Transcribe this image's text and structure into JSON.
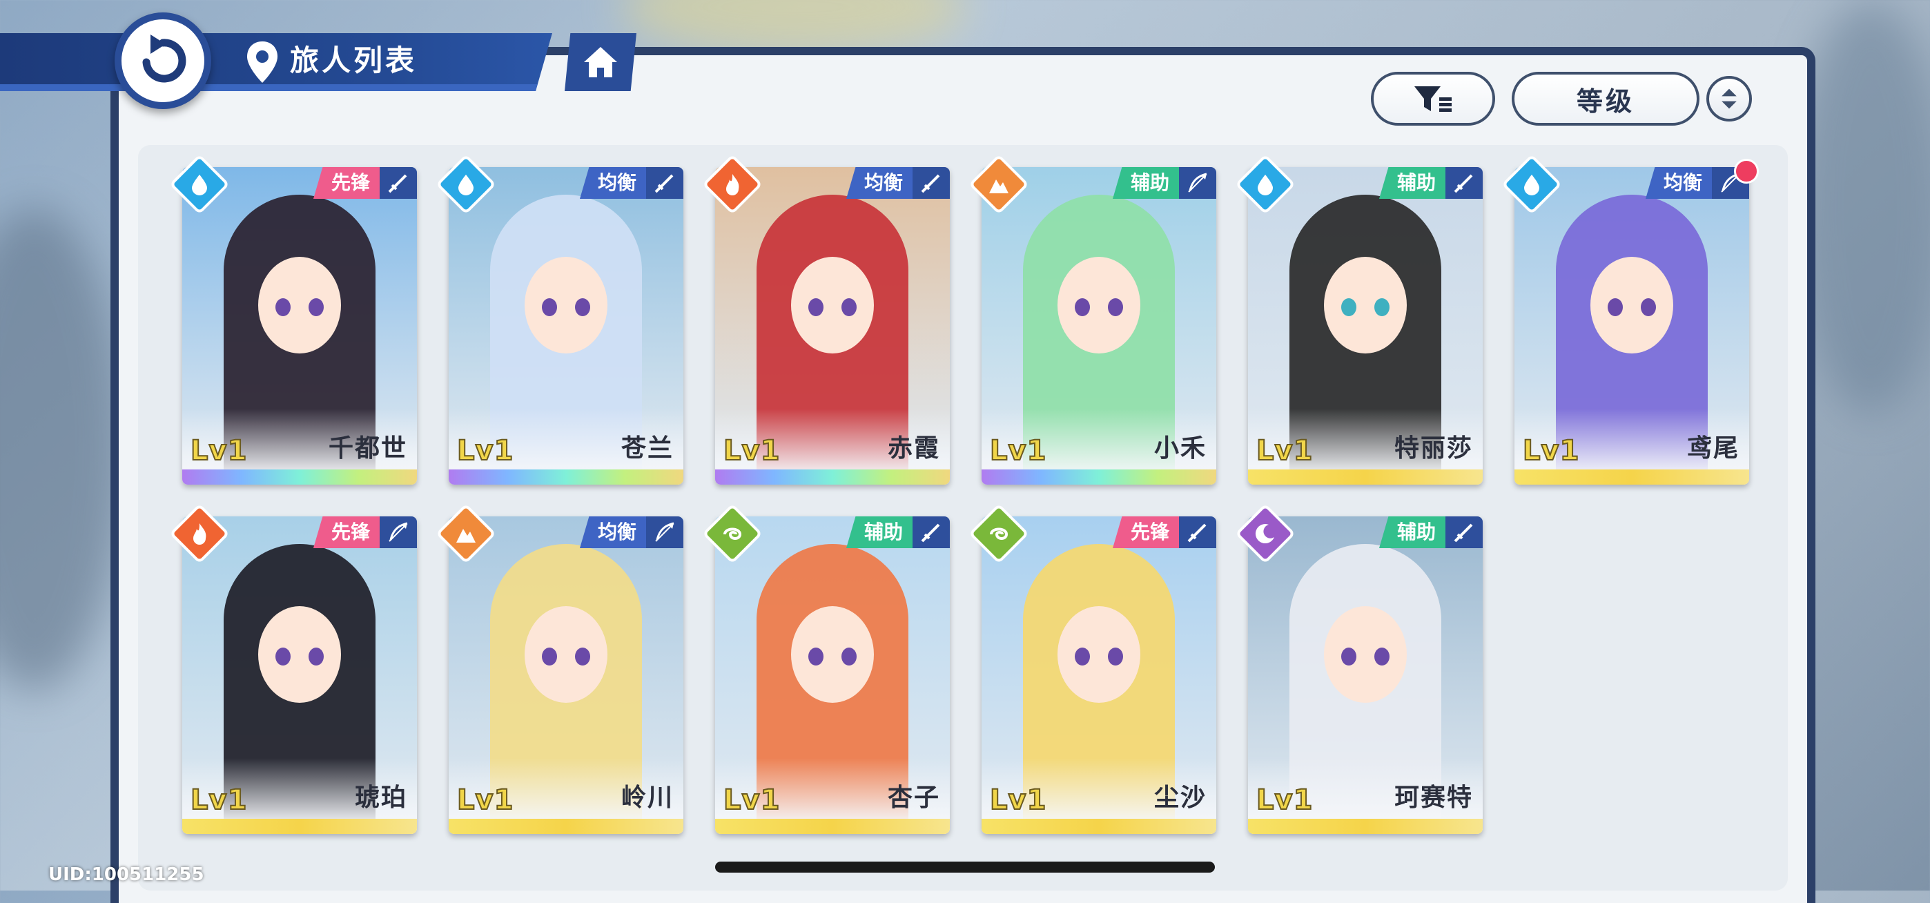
{
  "header": {
    "title": "旅人列表"
  },
  "toolbar": {
    "sort_label": "等级"
  },
  "footer": {
    "uid": "UID:100511255"
  },
  "colors": {
    "water": "#29a9e6",
    "fire": "#f06432",
    "earth": "#f08a3a",
    "wind": "#7ab83a",
    "dark": "#9a5ac8",
    "vanguard": "#ef5c8c",
    "balance": "#3e64c4",
    "support": "#33c08d",
    "rarity_rainbow": "linear-gradient(90deg,#b07cf0,#7fb6ff,#7ff0d8,#c3f07f,#f0d87f)",
    "rarity_gold": "linear-gradient(90deg,#f7e267,#f5d44a,#f7e58e)"
  },
  "characters": [
    {
      "name": "千都世",
      "level": "Lv1",
      "role": "先锋",
      "element": "water",
      "weapon": "sword",
      "rarity": "rainbow",
      "hair": "#2a2230",
      "bg": "#7fb8e8"
    },
    {
      "name": "苍兰",
      "level": "Lv1",
      "role": "均衡",
      "element": "water",
      "weapon": "sword",
      "rarity": "rainbow",
      "hair": "#cfe0f5",
      "bg": "#8fbfe0"
    },
    {
      "name": "赤霞",
      "level": "Lv1",
      "role": "均衡",
      "element": "fire",
      "weapon": "sword",
      "rarity": "rainbow",
      "hair": "#c8343a",
      "bg": "#e0c0a0"
    },
    {
      "name": "小禾",
      "level": "Lv1",
      "role": "辅助",
      "element": "earth",
      "weapon": "bow",
      "rarity": "rainbow",
      "hair": "#8fe0a8",
      "bg": "#9fd0e8"
    },
    {
      "name": "特丽莎",
      "level": "Lv1",
      "role": "辅助",
      "element": "water",
      "weapon": "sword",
      "rarity": "gold",
      "hair": "#2a2a2a",
      "bg": "#c8d8e8"
    },
    {
      "name": "鸢尾",
      "level": "Lv1",
      "role": "均衡",
      "element": "water",
      "weapon": "bow",
      "rarity": "gold",
      "hair": "#7a6ad8",
      "bg": "#9fc8e8"
    },
    {
      "name": "琥珀",
      "level": "Lv1",
      "role": "先锋",
      "element": "fire",
      "weapon": "bow",
      "rarity": "gold",
      "hair": "#1e1e28",
      "bg": "#a8d0e8"
    },
    {
      "name": "岭川",
      "level": "Lv1",
      "role": "均衡",
      "element": "earth",
      "weapon": "bow",
      "rarity": "gold",
      "hair": "#f2dc8a",
      "bg": "#a8c8e0"
    },
    {
      "name": "杏子",
      "level": "Lv1",
      "role": "辅助",
      "element": "wind",
      "weapon": "sword",
      "rarity": "gold",
      "hair": "#ef7a48",
      "bg": "#b8d8f0"
    },
    {
      "name": "尘沙",
      "level": "Lv1",
      "role": "先锋",
      "element": "wind",
      "weapon": "sword",
      "rarity": "gold",
      "hair": "#f5d870",
      "bg": "#a8d0f0"
    },
    {
      "name": "珂赛特",
      "level": "Lv1",
      "role": "辅助",
      "element": "dark",
      "weapon": "sword",
      "rarity": "gold",
      "hair": "#e8ecf2",
      "bg": "#9ab8d0"
    }
  ]
}
